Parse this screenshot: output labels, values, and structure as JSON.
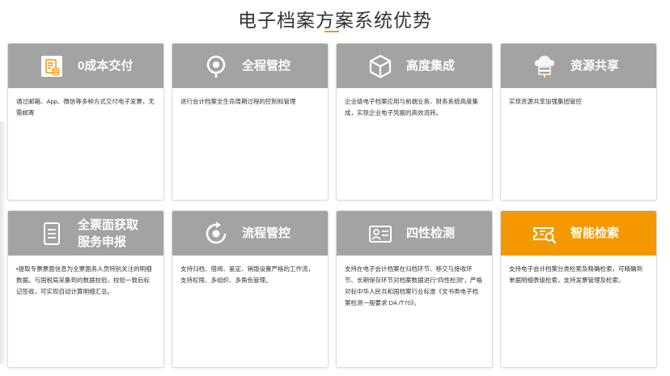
{
  "header": {
    "title": "电子档案方案系统优势"
  },
  "colors": {
    "head_gray": "#a3a3a3",
    "accent_orange": "#f39800"
  },
  "cards": [
    {
      "title": "0成本交付",
      "icon": "document-coins-icon",
      "desc": "通过邮箱、App、微信等多种方式交付电子发票，无需邮寄"
    },
    {
      "title": "全程管控",
      "icon": "location-pin-icon",
      "desc": "进行会计档案全生命周期过程的控制和管理"
    },
    {
      "title": "高度集成",
      "icon": "cube-icon",
      "desc": "企业级电子档案应用与前端业务、财务系统高度集成，实现企业电子凭据的高效流转。"
    },
    {
      "title": "资源共享",
      "icon": "cloud-server-icon",
      "desc": "实现资源共享加强集团管控"
    },
    {
      "title": "全票面获取服务申报",
      "icon": "document-list-icon",
      "desc": "•提取专票票面信息为全票面务人员特别关注的明细数据。与国税局采集到的数据校验，校验一致后标记签收，可实现自动计算明细汇总。"
    },
    {
      "title": "流程管控",
      "icon": "cycle-arrow-icon",
      "desc": "支持归档、借阅、鉴定、销毁设置严格的工作流，支持权限、多组织、多角色管理。"
    },
    {
      "title": "四性检测",
      "icon": "id-card-icon",
      "desc": "支持在电子会计档案在归档环节、移交与接收环节、长期保存环节对档案数据进行“四性检测”，严格对标中华人民共和国档案行业标准《文书类电子档案检测一般要求 DA /T70》。"
    },
    {
      "title": "智能检索",
      "icon": "ticket-search-icon",
      "desc": "支持电子会计档案分类检索及精确检索，可精确到单据明细表级检索，支持发票管理及检索。"
    }
  ]
}
